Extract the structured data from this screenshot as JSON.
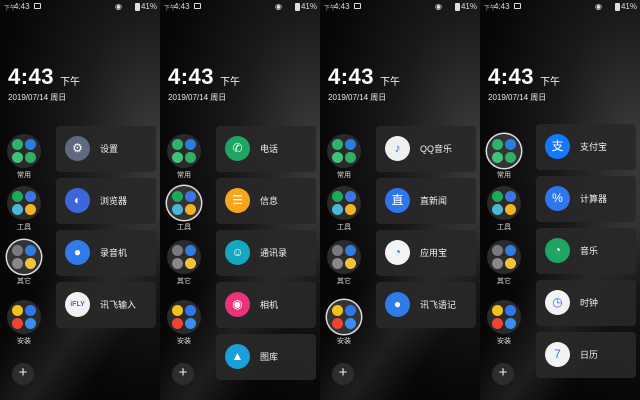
{
  "status": {
    "small_text": "下午",
    "time": "4:43",
    "eye_icon": "eye-icon",
    "battery_percent": "41%"
  },
  "lock": {
    "time": "4:43",
    "ampm": "下午",
    "date": "2019/07/14 周日"
  },
  "folders": [
    {
      "label": "常用",
      "dots": [
        "#2fb36b",
        "#2a7de1",
        "#3cc47a",
        "#30b060"
      ]
    },
    {
      "label": "工具",
      "dots": [
        "#20a85a",
        "#3d74e6",
        "#4cb6d9",
        "#f3b02a"
      ]
    },
    {
      "label": "其它",
      "dots": [
        "#7a7a7a",
        "#2f7be8",
        "#888888",
        "#f4c13a"
      ]
    },
    {
      "label": "安装",
      "dots": [
        "#f0c020",
        "#2e77ea",
        "#ee4433",
        "#3c8bf0"
      ]
    }
  ],
  "add_button": "+",
  "panels": [
    {
      "selected_folder": 2,
      "items": [
        {
          "label": "设置",
          "icon": "gear-icon",
          "color": "#606a7e",
          "glyph": "⚙"
        },
        {
          "label": "浏览器",
          "icon": "browser-icon",
          "color": "#3d67d8",
          "glyph": "◐"
        },
        {
          "label": "录音机",
          "icon": "microphone-icon",
          "color": "#2f7be8",
          "glyph": "●"
        },
        {
          "label": "讯飞输入",
          "icon": "iflytek-icon",
          "color": "#f2f2f2",
          "glyph": "iFLY"
        }
      ]
    },
    {
      "selected_folder": 1,
      "items": [
        {
          "label": "电话",
          "icon": "phone-icon",
          "color": "#1fa463",
          "glyph": "✆"
        },
        {
          "label": "信息",
          "icon": "message-icon",
          "color": "#f3a61e",
          "glyph": "☰"
        },
        {
          "label": "通讯录",
          "icon": "contacts-icon",
          "color": "#16a7c0",
          "glyph": "☺"
        },
        {
          "label": "相机",
          "icon": "camera-icon",
          "color": "#e8347a",
          "glyph": "◉"
        },
        {
          "label": "图库",
          "icon": "gallery-icon",
          "color": "#1b9fd8",
          "glyph": "▲"
        }
      ]
    },
    {
      "selected_folder": 3,
      "items": [
        {
          "label": "QQ音乐",
          "icon": "qq-music-icon",
          "color": "#f0f0f0",
          "glyph": "♪"
        },
        {
          "label": "直新闻",
          "icon": "news-icon",
          "color": "#2e77ea",
          "glyph": "直"
        },
        {
          "label": "应用宝",
          "icon": "app-store-icon",
          "color": "#f4f4f4",
          "glyph": "◔"
        },
        {
          "label": "讯飞语记",
          "icon": "iflytek-notes-icon",
          "color": "#2f7be8",
          "glyph": "●"
        }
      ]
    },
    {
      "selected_folder": 0,
      "items": [
        {
          "label": "支付宝",
          "icon": "alipay-icon",
          "color": "#1677ff",
          "glyph": "支"
        },
        {
          "label": "计算器",
          "icon": "calculator-icon",
          "color": "#2e77ea",
          "glyph": "%"
        },
        {
          "label": "音乐",
          "icon": "music-icon",
          "color": "#1fa463",
          "glyph": "◔"
        },
        {
          "label": "时钟",
          "icon": "clock-icon",
          "color": "#f2f2f2",
          "glyph": "◷"
        },
        {
          "label": "日历",
          "icon": "calendar-icon",
          "color": "#f2f2f2",
          "glyph": "7"
        }
      ]
    }
  ]
}
